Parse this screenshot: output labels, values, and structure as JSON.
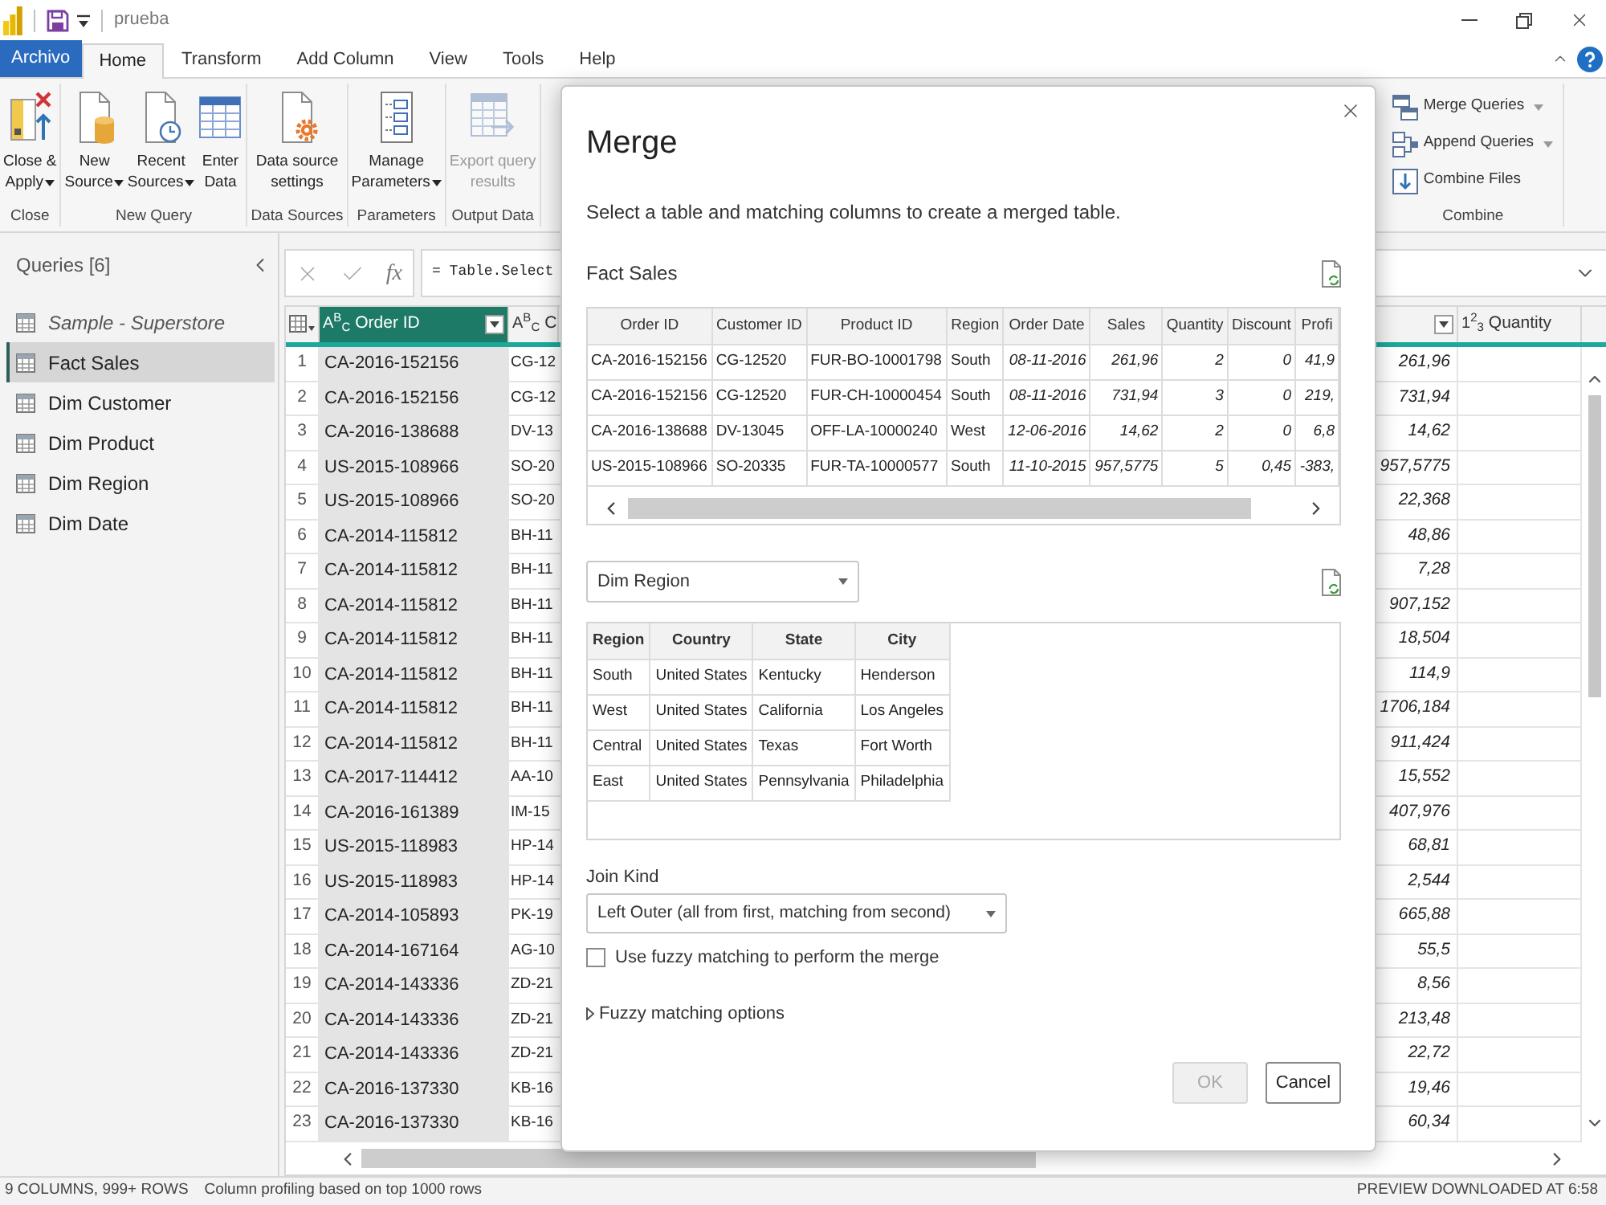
{
  "title_bar": {
    "file_name": "prueba"
  },
  "menu_tabs": [
    {
      "label": "Archivo",
      "kind": "file",
      "selected": false
    },
    {
      "label": "Home",
      "kind": "tab",
      "selected": true
    },
    {
      "label": "Transform",
      "kind": "tab",
      "selected": false
    },
    {
      "label": "Add Column",
      "kind": "tab",
      "selected": false
    },
    {
      "label": "View",
      "kind": "tab",
      "selected": false
    },
    {
      "label": "Tools",
      "kind": "tab",
      "selected": false
    },
    {
      "label": "Help",
      "kind": "tab",
      "selected": false
    }
  ],
  "ribbon": {
    "groups": [
      {
        "label": "Close",
        "buttons": [
          {
            "kind": "close",
            "lines": [
              "Close &",
              "Apply"
            ],
            "has_menu": true,
            "disabled": false
          }
        ]
      },
      {
        "label": "New Query",
        "buttons": [
          {
            "kind": "source",
            "lines": [
              "New",
              "Source"
            ],
            "has_menu": true,
            "disabled": false
          },
          {
            "kind": "recent",
            "lines": [
              "Recent",
              "Sources"
            ],
            "has_menu": true,
            "disabled": false
          },
          {
            "kind": "table",
            "lines": [
              "Enter",
              "Data"
            ],
            "has_menu": false,
            "disabled": false
          }
        ]
      },
      {
        "label": "Data Sources",
        "buttons": [
          {
            "kind": "settings",
            "lines": [
              "Data source",
              "settings"
            ],
            "has_menu": false,
            "disabled": false
          }
        ]
      },
      {
        "label": "Parameters",
        "buttons": [
          {
            "kind": "parameters",
            "lines": [
              "Manage",
              "Parameters"
            ],
            "has_menu": true,
            "disabled": false
          }
        ]
      },
      {
        "label": "Output Data",
        "buttons": [
          {
            "kind": "export",
            "lines": [
              "Export query",
              "results"
            ],
            "has_menu": false,
            "disabled": true
          }
        ]
      }
    ],
    "combine": {
      "label": "Combine",
      "buttons": [
        {
          "label": "Merge Queries",
          "has_menu": true
        },
        {
          "label": "Append Queries",
          "has_menu": true
        },
        {
          "label": "Combine Files",
          "has_menu": false
        }
      ]
    }
  },
  "queries": {
    "title": "Queries [6]",
    "items": [
      {
        "label": "Sample - Superstore",
        "load_disabled": true,
        "selected": false
      },
      {
        "label": "Fact Sales",
        "load_disabled": false,
        "selected": true
      },
      {
        "label": "Dim Customer",
        "load_disabled": false,
        "selected": false
      },
      {
        "label": "Dim Product",
        "load_disabled": false,
        "selected": false
      },
      {
        "label": "Dim Region",
        "load_disabled": false,
        "selected": false
      },
      {
        "label": "Dim Date",
        "load_disabled": false,
        "selected": false
      }
    ]
  },
  "formula_bar": {
    "fx": "fx",
    "formula": "= Table.Select"
  },
  "grid": {
    "columns": [
      {
        "type_label": "A$^{B}$$_{C}$",
        "label": "Order ID",
        "has_filter": true,
        "selected": true
      },
      {
        "type_label": "A$^{B}$$_{C}$",
        "label": "C",
        "has_filter": false,
        "selected": false
      },
      {
        "has_filter": true,
        "selected": false
      },
      {
        "type_label": "1$^{2}$$_{3}$",
        "label": "Quantity",
        "has_filter": false,
        "selected": false
      }
    ],
    "rows": [
      {
        "number": "1",
        "order_id": "CA-2016-152156",
        "column_2": "CG-12",
        "column_3": "261,96"
      },
      {
        "number": "2",
        "order_id": "CA-2016-152156",
        "column_2": "CG-12",
        "column_3": "731,94"
      },
      {
        "number": "3",
        "order_id": "CA-2016-138688",
        "column_2": "DV-13",
        "column_3": "14,62"
      },
      {
        "number": "4",
        "order_id": "US-2015-108966",
        "column_2": "SO-20",
        "column_3": "957,5775"
      },
      {
        "number": "5",
        "order_id": "US-2015-108966",
        "column_2": "SO-20",
        "column_3": "22,368"
      },
      {
        "number": "6",
        "order_id": "CA-2014-115812",
        "column_2": "BH-11",
        "column_3": "48,86"
      },
      {
        "number": "7",
        "order_id": "CA-2014-115812",
        "column_2": "BH-11",
        "column_3": "7,28"
      },
      {
        "number": "8",
        "order_id": "CA-2014-115812",
        "column_2": "BH-11",
        "column_3": "907,152"
      },
      {
        "number": "9",
        "order_id": "CA-2014-115812",
        "column_2": "BH-11",
        "column_3": "18,504"
      },
      {
        "number": "10",
        "order_id": "CA-2014-115812",
        "column_2": "BH-11",
        "column_3": "114,9"
      },
      {
        "number": "11",
        "order_id": "CA-2014-115812",
        "column_2": "BH-11",
        "column_3": "1706,184"
      },
      {
        "number": "12",
        "order_id": "CA-2014-115812",
        "column_2": "BH-11",
        "column_3": "911,424"
      },
      {
        "number": "13",
        "order_id": "CA-2017-114412",
        "column_2": "AA-10",
        "column_3": "15,552"
      },
      {
        "number": "14",
        "order_id": "CA-2016-161389",
        "column_2": "IM-15",
        "column_3": "407,976"
      },
      {
        "number": "15",
        "order_id": "US-2015-118983",
        "column_2": "HP-14",
        "column_3": "68,81"
      },
      {
        "number": "16",
        "order_id": "US-2015-118983",
        "column_2": "HP-14",
        "column_3": "2,544"
      },
      {
        "number": "17",
        "order_id": "CA-2014-105893",
        "column_2": "PK-19",
        "column_3": "665,88"
      },
      {
        "number": "18",
        "order_id": "CA-2014-167164",
        "column_2": "AG-10",
        "column_3": "55,5"
      },
      {
        "number": "19",
        "order_id": "CA-2014-143336",
        "column_2": "ZD-21",
        "column_3": "8,56"
      },
      {
        "number": "20",
        "order_id": "CA-2014-143336",
        "column_2": "ZD-21",
        "column_3": "213,48"
      },
      {
        "number": "21",
        "order_id": "CA-2014-143336",
        "column_2": "ZD-21",
        "column_3": "22,72"
      },
      {
        "number": "22",
        "order_id": "CA-2016-137330",
        "column_2": "KB-16",
        "column_3": "19,46"
      },
      {
        "number": "23",
        "order_id": "CA-2016-137330",
        "column_2": "KB-16",
        "column_3": "60,34"
      }
    ]
  },
  "status_bar": {
    "shape": "9 COLUMNS, 999+ ROWS",
    "profiling": "Column profiling based on top 1000 rows",
    "preview": "PREVIEW DOWNLOADED AT 6:58"
  },
  "dialog": {
    "title": "Merge",
    "description": "Select a table and matching columns to create a merged table.",
    "first_table": {
      "name": "Fact Sales",
      "columns": [
        {
          "label": "Order ID",
          "numeric": false
        },
        {
          "label": "Customer ID",
          "numeric": false
        },
        {
          "label": "Product ID",
          "numeric": false
        },
        {
          "label": "Region",
          "numeric": false
        },
        {
          "label": "Order Date",
          "numeric": true
        },
        {
          "label": "Sales",
          "numeric": true
        },
        {
          "label": "Quantity",
          "numeric": true
        },
        {
          "label": "Discount",
          "numeric": true
        },
        {
          "label": "Profi",
          "numeric": true
        }
      ],
      "rows": [
        [
          "CA-2016-152156",
          "CG-12520",
          "FUR-BO-10001798",
          "South",
          "08-11-2016",
          "261,96",
          "2",
          "0",
          "41,9"
        ],
        [
          "CA-2016-152156",
          "CG-12520",
          "FUR-CH-10000454",
          "South",
          "08-11-2016",
          "731,94",
          "3",
          "0",
          "219,"
        ],
        [
          "CA-2016-138688",
          "DV-13045",
          "OFF-LA-10000240",
          "West",
          "12-06-2016",
          "14,62",
          "2",
          "0",
          "6,8"
        ],
        [
          "US-2015-108966",
          "SO-20335",
          "FUR-TA-10000577",
          "South",
          "11-10-2015",
          "957,5775",
          "5",
          "0,45",
          "-383,"
        ]
      ]
    },
    "second_table": {
      "selected_table": "Dim Region",
      "columns": [
        "Region",
        "Country",
        "State",
        "City"
      ],
      "rows": [
        [
          "South",
          "United States",
          "Kentucky",
          "Henderson"
        ],
        [
          "West",
          "United States",
          "California",
          "Los Angeles"
        ],
        [
          "Central",
          "United States",
          "Texas",
          "Fort Worth"
        ],
        [
          "East",
          "United States",
          "Pennsylvania",
          "Philadelphia"
        ]
      ]
    },
    "join_kind": {
      "label": "Join Kind",
      "value": "Left Outer (all from first, matching from second)"
    },
    "fuzzy_matching": {
      "label": "Use fuzzy matching to perform the merge",
      "checked": false
    },
    "fuzzy_options": {
      "label": "Fuzzy matching options",
      "expanded": false
    },
    "buttons": [
      {
        "label": "OK",
        "disabled": true
      },
      {
        "label": "Cancel",
        "disabled": false
      }
    ]
  }
}
